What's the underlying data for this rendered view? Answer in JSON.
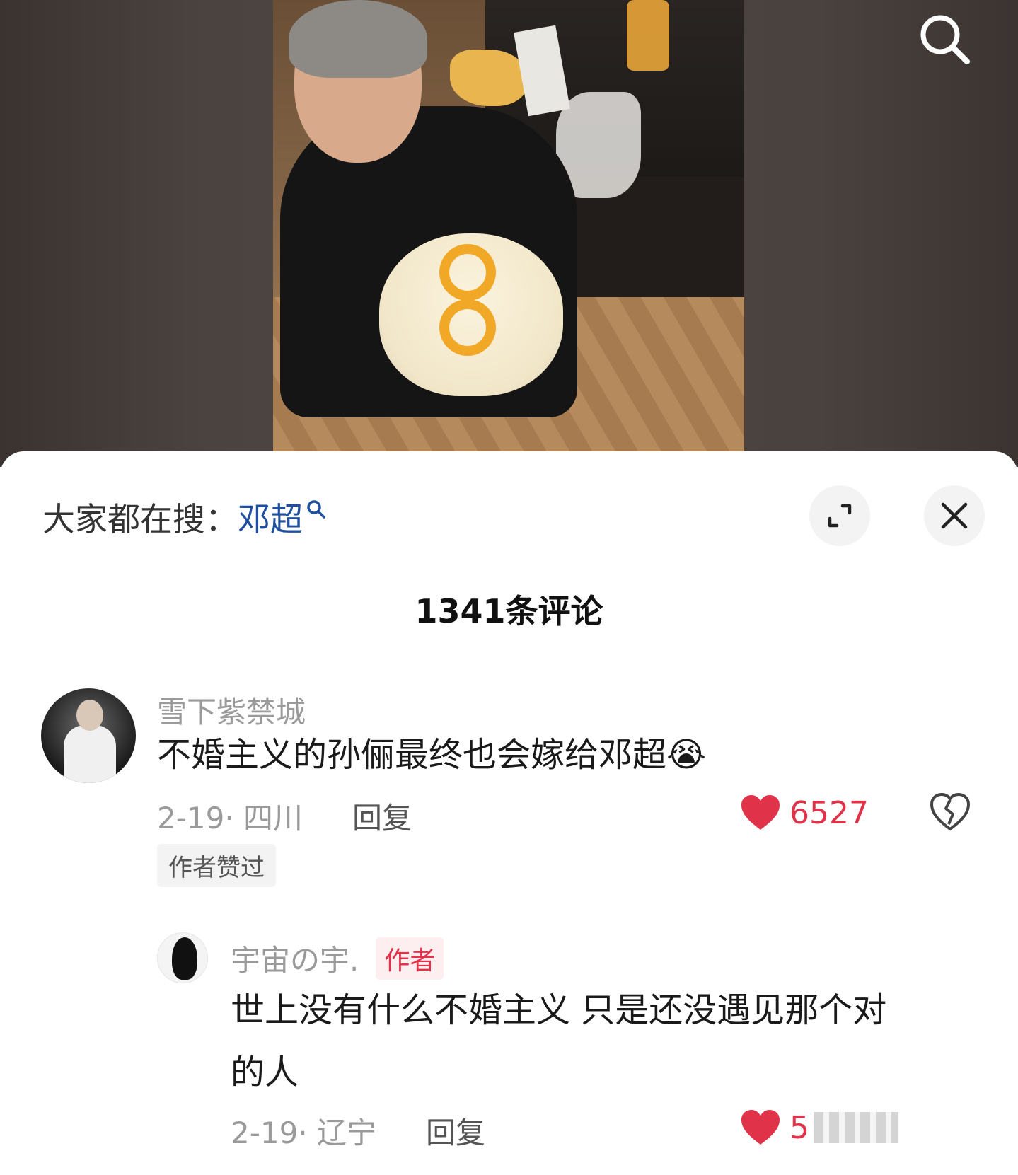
{
  "trending": {
    "label": "大家都在搜：",
    "term": "邓超"
  },
  "comments_header": {
    "title": "1341条评论"
  },
  "comments": [
    {
      "username": "雪下紫禁城",
      "text": "不婚主义的孙俪最终也会嫁给邓超",
      "emoji": "😭",
      "date_location": "2-19· 四川",
      "reply_label": "回复",
      "likes": "6527",
      "badge": "作者赞过"
    },
    {
      "username": "宇宙の宇.",
      "author_tag": "作者",
      "text_line1": "世上没有什么不婚主义 只是还没遇见那个对",
      "text_line2": "的人",
      "date_location": "2-19· 辽宁",
      "reply_label": "回复",
      "likes": "5"
    }
  ],
  "icons": {
    "search": "search-icon",
    "expand": "expand-icon",
    "close": "close-icon",
    "heart": "heart-icon",
    "dislike": "broken-heart-icon"
  },
  "colors": {
    "link_blue": "#1f4fa0",
    "like_red": "#e0334a",
    "meta_gray": "#9a9a9a"
  }
}
